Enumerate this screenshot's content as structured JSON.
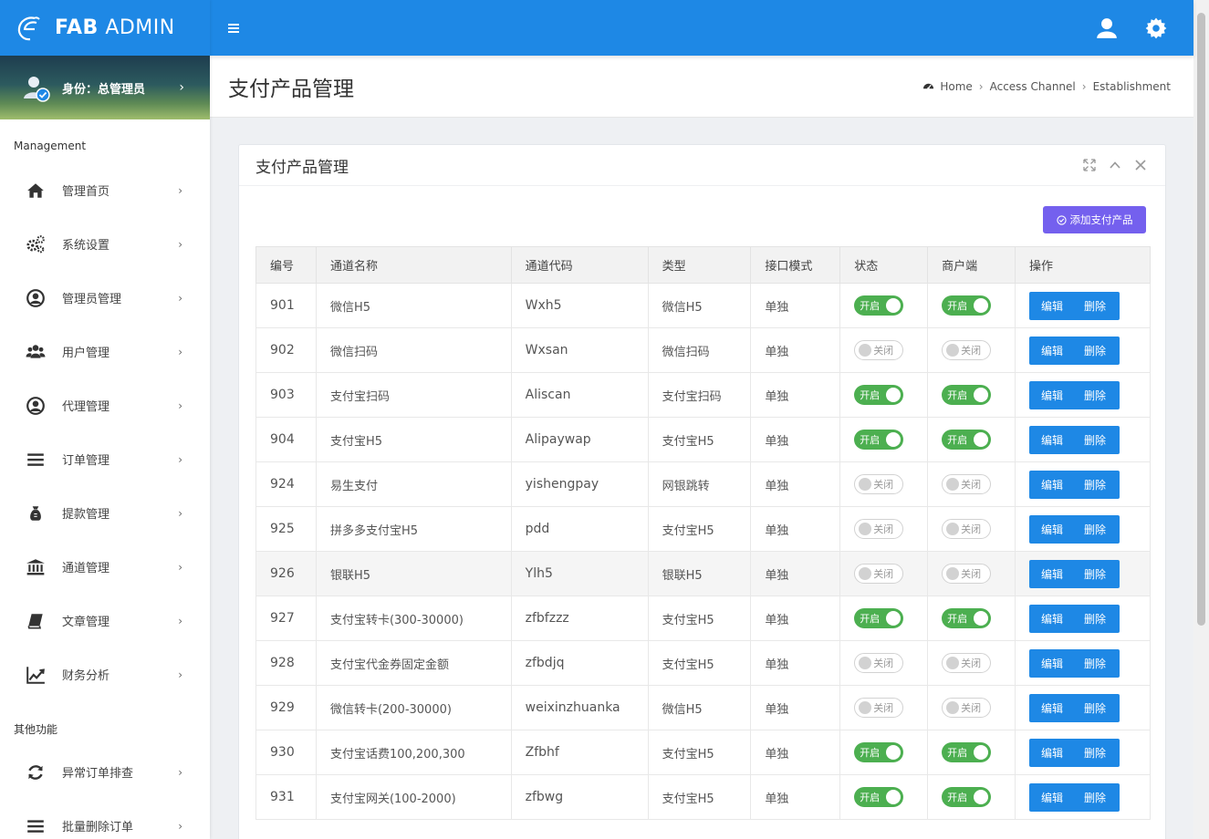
{
  "brand": {
    "bold": "FAB",
    "rest": "ADMIN"
  },
  "user_panel": {
    "role": "身份：总管理员"
  },
  "sidebar": {
    "section_main": "Management",
    "items": [
      {
        "label": "管理首页",
        "icon": "home-icon"
      },
      {
        "label": "系统设置",
        "icon": "gears-icon"
      },
      {
        "label": "管理员管理",
        "icon": "user-circle-icon"
      },
      {
        "label": "用户管理",
        "icon": "users-icon"
      },
      {
        "label": "代理管理",
        "icon": "user-circle-icon"
      },
      {
        "label": "订单管理",
        "icon": "list-icon"
      },
      {
        "label": "提款管理",
        "icon": "money-bag-icon"
      },
      {
        "label": "通道管理",
        "icon": "bank-icon"
      },
      {
        "label": "文章管理",
        "icon": "book-icon"
      },
      {
        "label": "财务分析",
        "icon": "line-chart-icon"
      }
    ],
    "section_other": "其他功能",
    "other_items": [
      {
        "label": "异常订单排查",
        "icon": "refresh-icon"
      },
      {
        "label": "批量删除订单",
        "icon": "list-icon"
      }
    ]
  },
  "page": {
    "title": "支付产品管理",
    "breadcrumb": [
      "Home",
      "Access Channel",
      "Establishment"
    ]
  },
  "card": {
    "title": "支付产品管理",
    "add_button": "添加支付产品"
  },
  "table": {
    "headers": [
      "编号",
      "通道名称",
      "通道代码",
      "类型",
      "接口模式",
      "状态",
      "商户端",
      "操作"
    ],
    "on_label": "开启",
    "off_label": "关闭",
    "edit_label": "编辑",
    "delete_label": "删除",
    "rows": [
      {
        "id": "901",
        "name": "微信H5",
        "code": "Wxh5",
        "type": "微信H5",
        "mode": "单独",
        "status": true,
        "merchant": true
      },
      {
        "id": "902",
        "name": "微信扫码",
        "code": "Wxsan",
        "type": "微信扫码",
        "mode": "单独",
        "status": false,
        "merchant": false
      },
      {
        "id": "903",
        "name": "支付宝扫码",
        "code": "Aliscan",
        "type": "支付宝扫码",
        "mode": "单独",
        "status": true,
        "merchant": true
      },
      {
        "id": "904",
        "name": "支付宝H5",
        "code": "Alipaywap",
        "type": "支付宝H5",
        "mode": "单独",
        "status": true,
        "merchant": true
      },
      {
        "id": "924",
        "name": "易生支付",
        "code": "yishengpay",
        "type": "网银跳转",
        "mode": "单独",
        "status": false,
        "merchant": false
      },
      {
        "id": "925",
        "name": "拼多多支付宝H5",
        "code": "pdd",
        "type": "支付宝H5",
        "mode": "单独",
        "status": false,
        "merchant": false
      },
      {
        "id": "926",
        "name": "银联H5",
        "code": "Ylh5",
        "type": "银联H5",
        "mode": "单独",
        "status": false,
        "merchant": false
      },
      {
        "id": "927",
        "name": "支付宝转卡(300-30000)",
        "code": "zfbfzzz",
        "type": "支付宝H5",
        "mode": "单独",
        "status": true,
        "merchant": true
      },
      {
        "id": "928",
        "name": "支付宝代金券固定金额",
        "code": "zfbdjq",
        "type": "支付宝H5",
        "mode": "单独",
        "status": false,
        "merchant": false
      },
      {
        "id": "929",
        "name": "微信转卡(200-30000)",
        "code": "weixinzhuanka",
        "type": "微信H5",
        "mode": "单独",
        "status": false,
        "merchant": false
      },
      {
        "id": "930",
        "name": "支付宝话费100,200,300",
        "code": "Zfbhf",
        "type": "支付宝H5",
        "mode": "单独",
        "status": true,
        "merchant": true
      },
      {
        "id": "931",
        "name": "支付宝网关(100-2000)",
        "code": "zfbwg",
        "type": "支付宝H5",
        "mode": "单独",
        "status": true,
        "merchant": true
      }
    ]
  },
  "colors": {
    "primary": "#1e88e5",
    "accent": "#7460ee",
    "on": "#4caf50"
  }
}
